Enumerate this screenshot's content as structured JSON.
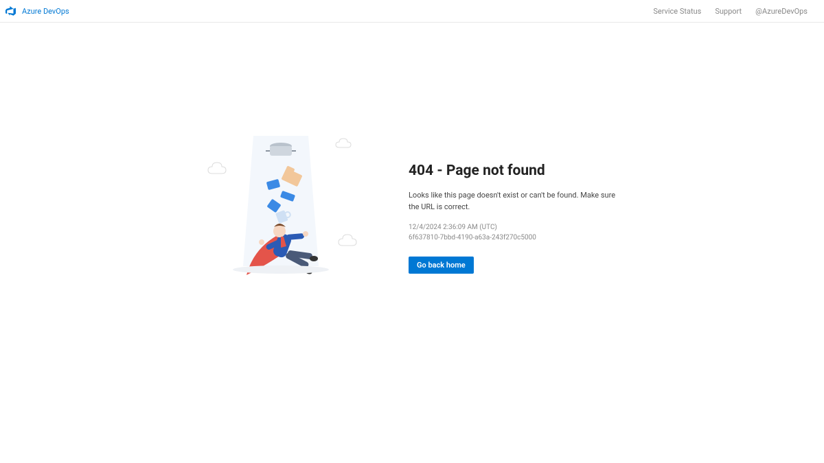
{
  "header": {
    "brand": "Azure DevOps",
    "links": {
      "status": "Service Status",
      "support": "Support",
      "twitter": "@AzureDevOps"
    }
  },
  "error": {
    "title": "404 - Page not found",
    "description": "Looks like this page doesn't exist or can't be found. Make sure the URL is correct.",
    "timestamp": "12/4/2024 2:36:09 AM (UTC)",
    "request_id": "6f637810-7bbd-4190-a63a-243f270c5000",
    "button": "Go back home"
  }
}
